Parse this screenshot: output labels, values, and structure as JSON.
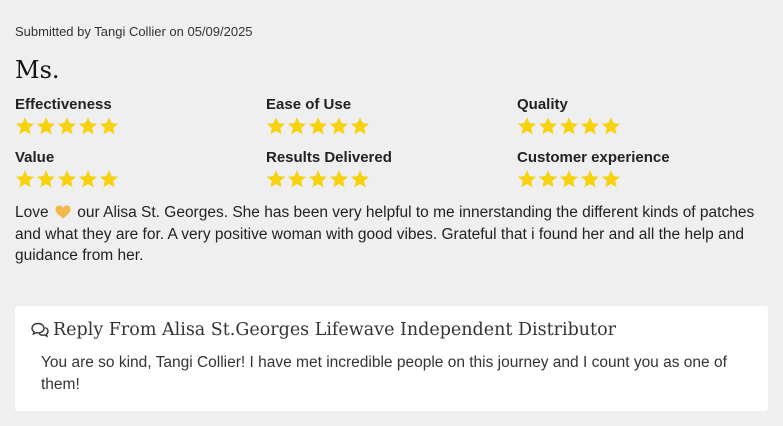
{
  "submitted": "Submitted by Tangi Collier on 05/09/2025",
  "title": "Ms.",
  "ratings": [
    {
      "label": "Effectiveness",
      "stars": 5,
      "max": 5
    },
    {
      "label": "Ease of Use",
      "stars": 5,
      "max": 5
    },
    {
      "label": "Quality",
      "stars": 5,
      "max": 5
    },
    {
      "label": "Value",
      "stars": 5,
      "max": 5
    },
    {
      "label": "Results Delivered",
      "stars": 5,
      "max": 5
    },
    {
      "label": "Customer experience",
      "stars": 5,
      "max": 5
    }
  ],
  "review": {
    "before_icon": "Love",
    "icon": "heart-icon",
    "after_icon": "our Alisa St. Georges. She has been very helpful to me innerstanding the different kinds of patches and what they are for. A very positive woman with good vibes. Grateful that i found her and all the help and guidance from her."
  },
  "reply": {
    "icon": "chat-icon",
    "heading": "Reply From Alisa St.Georges Lifewave Independent Distributor",
    "body": "You are so kind, Tangi Collier! I have met incredible people on this journey and I count you as one of them!"
  },
  "colors": {
    "star": "#f6d20f",
    "heart": "#f2b84b",
    "background": "#efefef",
    "card": "#ffffff"
  }
}
